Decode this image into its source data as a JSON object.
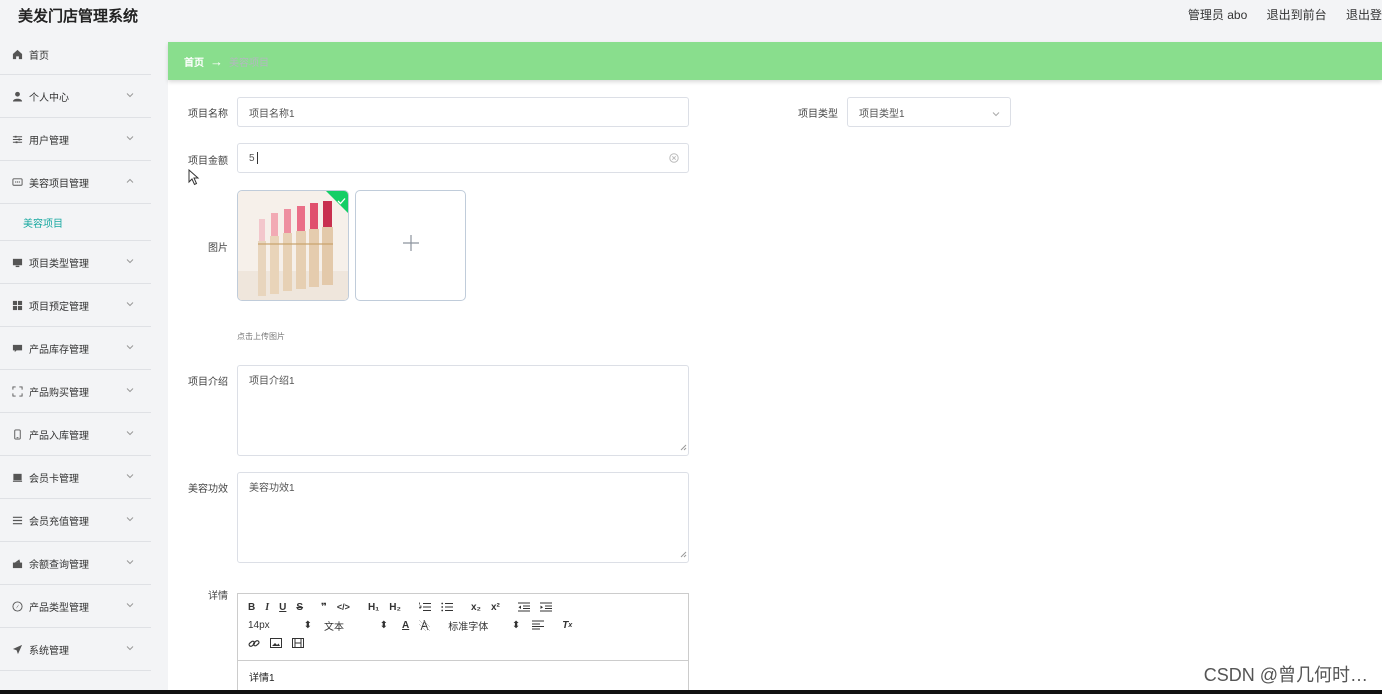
{
  "header": {
    "app_title": "美发门店管理系统",
    "admin_label": "管理员 abo",
    "exit_front_label": "退出到前台",
    "logout_label": "退出登录"
  },
  "sidebar": {
    "items": [
      {
        "label": "首页",
        "icon": "home-icon"
      },
      {
        "label": "个人中心",
        "icon": "user-icon"
      },
      {
        "label": "用户管理",
        "icon": "sliders-icon"
      },
      {
        "label": "美容项目管理",
        "icon": "chat-icon",
        "expanded": true
      },
      {
        "label": "项目类型管理",
        "icon": "monitor-icon"
      },
      {
        "label": "项目预定管理",
        "icon": "grid-icon"
      },
      {
        "label": "产品库存管理",
        "icon": "message-icon"
      },
      {
        "label": "产品购买管理",
        "icon": "fullscreen-icon"
      },
      {
        "label": "产品入库管理",
        "icon": "phone-icon"
      },
      {
        "label": "会员卡管理",
        "icon": "card-icon"
      },
      {
        "label": "会员充值管理",
        "icon": "list-icon"
      },
      {
        "label": "余额查询管理",
        "icon": "wallet-icon"
      },
      {
        "label": "产品类型管理",
        "icon": "compass-icon"
      },
      {
        "label": "系统管理",
        "icon": "send-icon"
      }
    ],
    "sub_item": "美容项目"
  },
  "breadcrumb": {
    "home": "首页",
    "arrow": "→",
    "current": "美容项目"
  },
  "form": {
    "name_label": "项目名称",
    "name_value": "项目名称1",
    "type_label": "项目类型",
    "type_value": "项目类型1",
    "amount_label": "项目金额",
    "amount_value": "5",
    "image_label": "图片",
    "upload_tip": "点击上传图片",
    "intro_label": "项目介绍",
    "intro_value": "项目介绍1",
    "effect_label": "美容功效",
    "effect_value": "美容功效1",
    "detail_label": "详情"
  },
  "editor": {
    "font_size": "14px",
    "paragraph": "文本",
    "font_family": "标准字体",
    "content": "详情1"
  },
  "watermark": "CSDN @曾几何时…"
}
